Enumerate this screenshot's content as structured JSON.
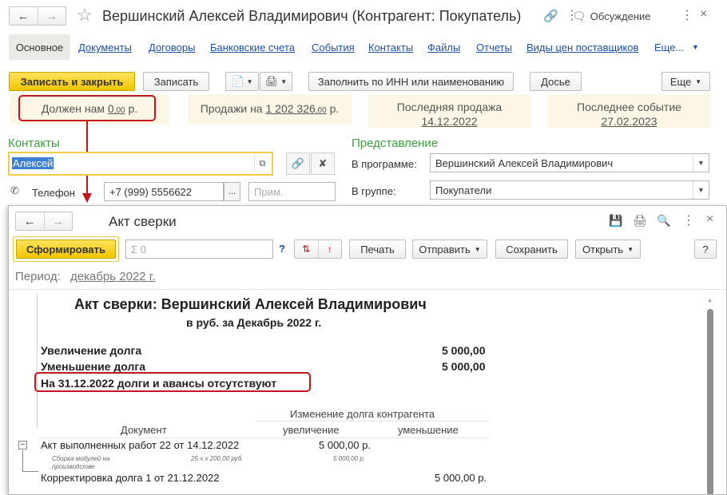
{
  "main_window": {
    "title": "Вершинский Алексей Владимирович (Контрагент: Покупатель)",
    "discussion_label": "Обсуждение",
    "tabs": [
      "Основное",
      "Документы",
      "Договоры",
      "Банковские счета",
      "События",
      "Контакты",
      "Файлы",
      "Отчеты",
      "Виды цен поставщиков",
      "Еще..."
    ],
    "toolbar": {
      "save_close": "Записать и закрыть",
      "save": "Записать",
      "fill_inn": "Заполнить по ИНН или наименованию",
      "dossier": "Досье",
      "more": "Еще"
    },
    "info": {
      "debt_prefix": "Должен нам ",
      "debt_int": "0",
      "debt_cents": ",00",
      "debt_suffix": " р.",
      "sales_prefix": "Продажи на ",
      "sales_int": "1 202 326",
      "sales_cents": ",00",
      "sales_suffix": " р.",
      "last_sale_label": "Последняя продажа",
      "last_sale_date": "14.12.2022",
      "last_event_label": "Последнее событие",
      "last_event_date": "27.02.2023"
    },
    "contacts": {
      "heading": "Контакты",
      "name_value": "Алексей",
      "phone_label": "Телефон",
      "phone_value": "+7 (999) 5556622",
      "phone_more": "...",
      "note_placeholder": "Прим."
    },
    "representation": {
      "heading": "Представление",
      "program_label": "В программе:",
      "program_value": "Вершинский Алексей Владимирович",
      "group_label": "В группе:",
      "group_value": "Покупатели"
    }
  },
  "report_window": {
    "title": "Акт сверки",
    "generate": "Сформировать",
    "sum_placeholder": "Σ 0",
    "help_q": "?",
    "print": "Печать",
    "send": "Отправить",
    "save": "Сохранить",
    "open": "Открыть",
    "help_btn": "?",
    "period_label": "Период:",
    "period_value": "декабрь 2022 г.",
    "report": {
      "title": "Акт сверки: Вершинский Алексей Владимирович",
      "subtitle": "в руб. за Декабрь 2022 г.",
      "increase_label": "Увеличение долга",
      "increase_value": "5 000,00",
      "decrease_label": "Уменьшение долга",
      "decrease_value": "5 000,00",
      "status": "На 31.12.2022 долги и авансы отсутствуют",
      "table_group_header": "Изменение долга контрагента",
      "col_document": "Документ",
      "col_increase": "увеличение",
      "col_decrease": "уменьшение",
      "rows": [
        {
          "doc": "Акт выполненных работ 22 от 14.12.2022",
          "increase": "5 000,00 р.",
          "decrease": "",
          "sub_doc_line1": "Сборка модулей на",
          "sub_doc_line2": "производстве",
          "sub_qty": "25 ч х 200,00 руб.",
          "sub_increase": "5 000,00 р."
        },
        {
          "doc": "Корректировка долга 1 от 21.12.2022",
          "increase": "",
          "decrease": "5 000,00 р."
        }
      ],
      "collapse_symbol": "−"
    }
  },
  "colors": {
    "accent_yellow": "#f2c400",
    "link_blue": "#1f4f9e",
    "section_green": "#3c9e3c",
    "highlight_red": "#c3161c",
    "info_bg": "#fbf6e6"
  }
}
